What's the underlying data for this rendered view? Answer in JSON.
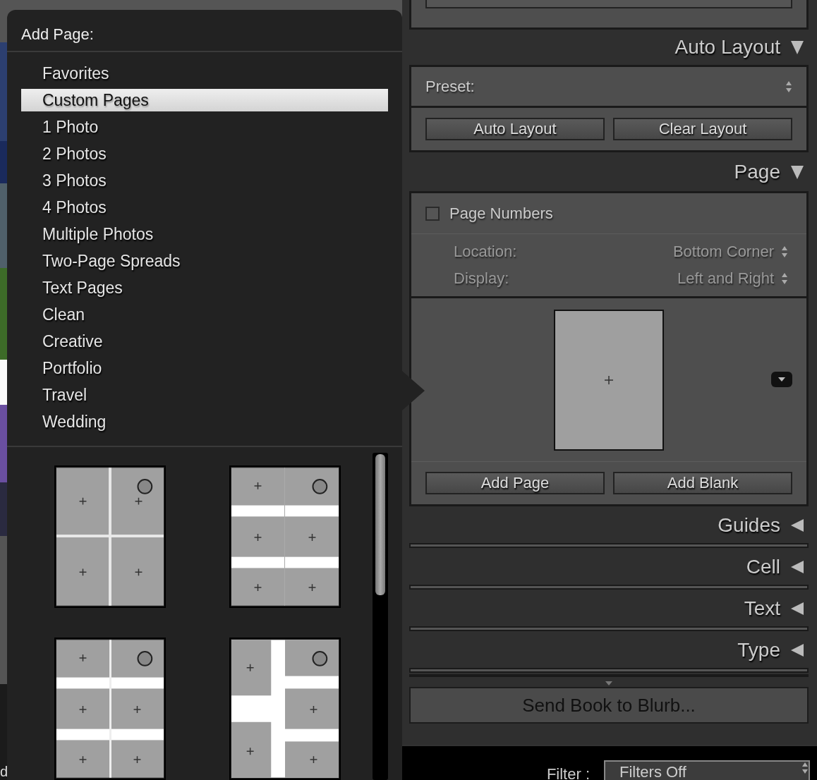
{
  "menu": {
    "title": "Add Page:",
    "items": [
      {
        "label": "Favorites",
        "selected": false
      },
      {
        "label": "Custom Pages",
        "selected": true
      },
      {
        "label": "1 Photo",
        "selected": false
      },
      {
        "label": "2 Photos",
        "selected": false
      },
      {
        "label": "3 Photos",
        "selected": false
      },
      {
        "label": "4 Photos",
        "selected": false
      },
      {
        "label": "Multiple Photos",
        "selected": false
      },
      {
        "label": "Two-Page Spreads",
        "selected": false
      },
      {
        "label": "Text Pages",
        "selected": false
      },
      {
        "label": "Clean",
        "selected": false
      },
      {
        "label": "Creative",
        "selected": false
      },
      {
        "label": "Portfolio",
        "selected": false
      },
      {
        "label": "Travel",
        "selected": false
      },
      {
        "label": "Wedding",
        "selected": false
      }
    ],
    "layouts": [
      {
        "kind": "quad"
      },
      {
        "kind": "rows"
      },
      {
        "kind": "rows-split"
      },
      {
        "kind": "column-split"
      }
    ]
  },
  "panel": {
    "auto_layout": {
      "title": "Auto Layout",
      "expanded": true,
      "preset_label": "Preset:",
      "buttons": [
        "Auto Layout",
        "Clear Layout"
      ]
    },
    "page": {
      "title": "Page",
      "expanded": true,
      "page_numbers": {
        "label": "Page Numbers",
        "checked": false
      },
      "options": [
        {
          "label": "Location:",
          "value": "Bottom Corner",
          "disabled": true
        },
        {
          "label": "Display:",
          "value": "Left and Right",
          "disabled": true
        }
      ],
      "buttons": [
        "Add Page",
        "Add Blank"
      ]
    },
    "sections": [
      {
        "title": "Guides",
        "expanded": false
      },
      {
        "title": "Cell",
        "expanded": false
      },
      {
        "title": "Text",
        "expanded": false
      },
      {
        "title": "Type",
        "expanded": false
      }
    ],
    "send_button": {
      "label": "Send Book to Blurb...",
      "disabled": true
    }
  },
  "filter": {
    "label": "Filter :",
    "value": "Filters Off"
  },
  "edge_text": "d"
}
